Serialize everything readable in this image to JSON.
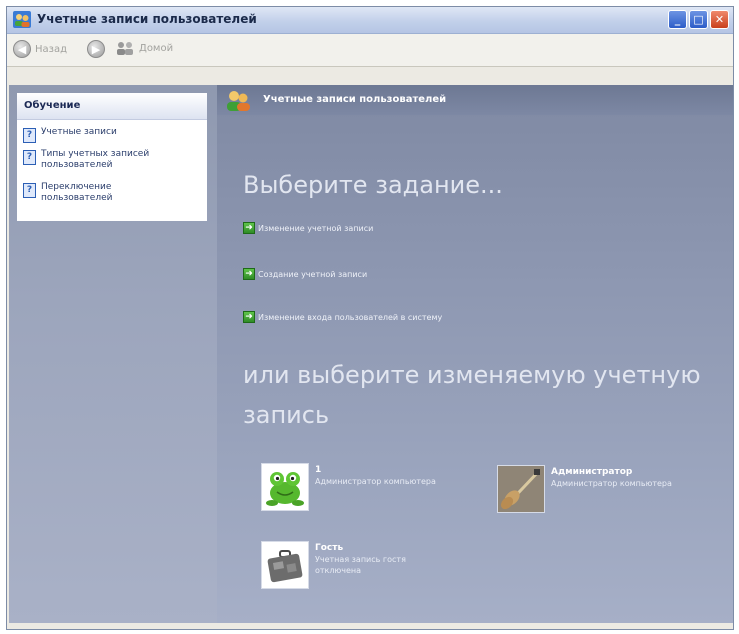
{
  "window": {
    "title": "Учетные записи пользователей",
    "controls": {
      "minimize": "_",
      "maximize": "□",
      "close": "✕"
    }
  },
  "toolbar": {
    "back_label": "Назад",
    "forward_label": "",
    "home_label": "Домой",
    "icons": {
      "back": "back-arrow-icon",
      "forward": "forward-arrow-icon",
      "home": "home-icon"
    }
  },
  "sidebar": {
    "header": "Обучение",
    "items": [
      {
        "label": "Учетные записи"
      },
      {
        "label": "Типы учетных записей пользователей"
      },
      {
        "label": "Переключение пользователей"
      }
    ]
  },
  "main": {
    "header_title": "Учетные записи пользователей",
    "task_heading": "Выберите задание...",
    "tasks": [
      {
        "label": "Изменение учетной записи"
      },
      {
        "label": "Создание учетной записи"
      },
      {
        "label": "Изменение входа пользователей в систему"
      }
    ],
    "accounts_heading": "или выберите изменяемую учетную запись",
    "accounts": [
      {
        "name": "1",
        "desc": "Администратор компьютера",
        "avatar": "frog-icon"
      },
      {
        "name": "Администратор",
        "desc": "Администратор компьютера",
        "avatar": "guitar-icon"
      },
      {
        "name": "Гость",
        "desc": "Учетная запись гостя отключена",
        "avatar": "briefcase-icon"
      }
    ]
  },
  "colors": {
    "titlebar": "#c2d0ea",
    "right_pane": "#8d97b1",
    "task_arrow": "#3ea233",
    "close_button": "#c9401d"
  }
}
